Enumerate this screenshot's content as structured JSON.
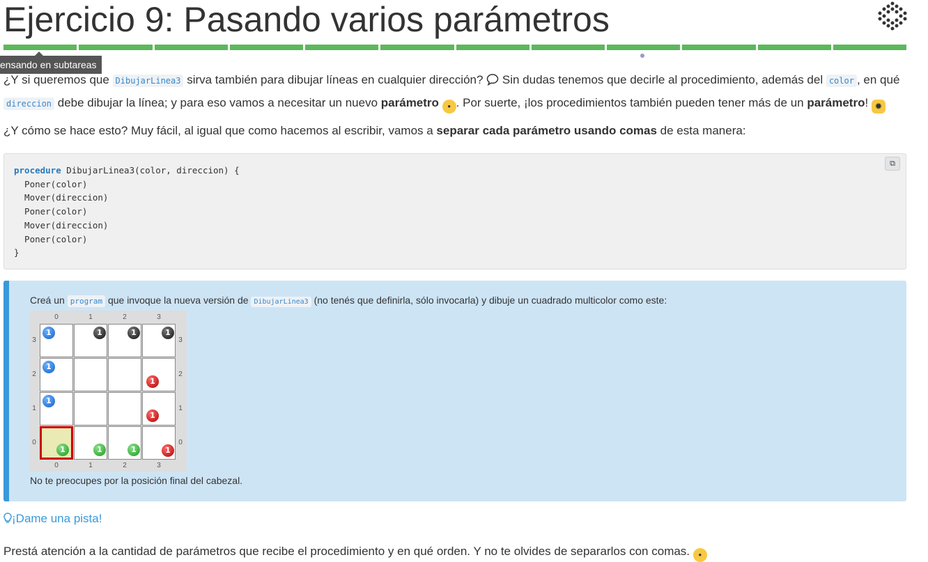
{
  "title": "Ejercicio 9: Pasando varios parámetros",
  "logo_icon": "gobstones-logo-icon",
  "progress_segments": 12,
  "tooltip": "ensando en subtareas",
  "para1": {
    "t1": "¿Y si queremos que ",
    "c1": "DibujarLinea3",
    "t2": " sirva también para dibujar líneas en cualquier dirección? ",
    "t3": " Sin dudas tenemos que decirle al procedimiento, además del ",
    "c2": "color",
    "t4": ", en qué ",
    "c3": "direccion",
    "t5": " debe dibujar la línea; y para eso vamos a necesitar un nuevo ",
    "b1": "parámetro",
    "t6": ". Por suerte, ¡los procedimientos también pueden tener más de un ",
    "b2": "parámetro",
    "t7": "!"
  },
  "para2": {
    "t1": "¿Y cómo se hace esto? Muy fácil, al igual que como hacemos al escribir, vamos a ",
    "b1": "separar cada parámetro usando comas",
    "t2": " de esta manera:"
  },
  "code": {
    "keyword": "procedure",
    "header_rest": " DibujarLinea3(color, direccion) {",
    "lines": [
      "  Poner(color)",
      "  Mover(direccion)",
      "  Poner(color)",
      "  Mover(direccion)",
      "  Poner(color)",
      "}"
    ],
    "copy_icon": "copy-icon"
  },
  "task": {
    "t1": "Creá un ",
    "c1": "program",
    "t2": " que invoque la nueva versión de ",
    "c2": "DibujarLinea3",
    "t3": " (no tenés que definirla, sólo invocarla) y dibuje un cuadrado multicolor como este:",
    "note": "No te preocupes por la posición final del cabezal."
  },
  "board": {
    "columns": [
      "0",
      "1",
      "2",
      "3"
    ],
    "rows": [
      "3",
      "2",
      "1",
      "0"
    ],
    "head": [
      0,
      0
    ],
    "balls": [
      {
        "x": 0,
        "y": 3,
        "color": "blue",
        "count": "1"
      },
      {
        "x": 1,
        "y": 3,
        "color": "black",
        "count": "1"
      },
      {
        "x": 2,
        "y": 3,
        "color": "black",
        "count": "1"
      },
      {
        "x": 3,
        "y": 3,
        "color": "black",
        "count": "1"
      },
      {
        "x": 0,
        "y": 2,
        "color": "blue",
        "count": "1"
      },
      {
        "x": 3,
        "y": 2,
        "color": "red",
        "count": "1"
      },
      {
        "x": 0,
        "y": 1,
        "color": "blue",
        "count": "1"
      },
      {
        "x": 3,
        "y": 1,
        "color": "red",
        "count": "1"
      },
      {
        "x": 0,
        "y": 0,
        "color": "green",
        "count": "1"
      },
      {
        "x": 1,
        "y": 0,
        "color": "green",
        "count": "1"
      },
      {
        "x": 2,
        "y": 0,
        "color": "green",
        "count": "1"
      },
      {
        "x": 3,
        "y": 0,
        "color": "red",
        "count": "1"
      }
    ]
  },
  "hint": {
    "icon": "lightbulb-icon",
    "label": "¡Dame una pista!"
  },
  "bottom": {
    "text": "Prestá atención a la cantidad de parámetros que recibe el procedimiento y en qué orden. Y no te olvides de separarlos con comas. "
  },
  "colors": {
    "accent": "#3a9ad9",
    "progress": "#5cb85c",
    "task_bg": "#cde4f5"
  }
}
